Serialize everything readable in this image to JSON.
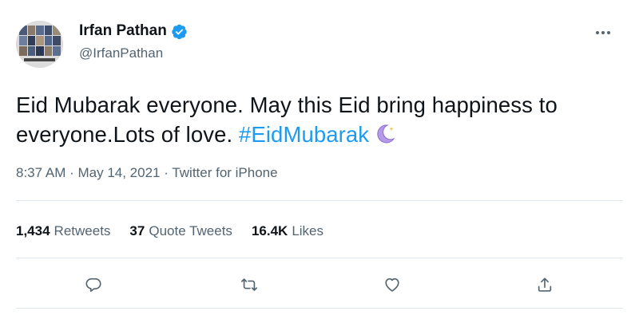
{
  "tweet": {
    "author_name": "Irfan Pathan",
    "handle": "@IrfanPathan",
    "text_main": "Eid Mubarak everyone. May this Eid bring happiness to everyone.Lots of love. ",
    "hashtag": "#EidMubarak",
    "time": "8:37 AM",
    "date": "May 14, 2021",
    "source": "Twitter for iPhone",
    "separator": " · "
  },
  "stats": {
    "retweets_count": "1,434",
    "retweets_label": "Retweets",
    "quotes_count": "37",
    "quotes_label": "Quote Tweets",
    "likes_count": "16.4K",
    "likes_label": "Likes"
  },
  "icons": {
    "verified": "verified-badge-icon",
    "more": "more-options-icon",
    "reply": "reply-icon",
    "retweet": "retweet-icon",
    "like": "like-icon",
    "share": "share-icon",
    "moon": "crescent-moon-emoji"
  },
  "colors": {
    "accent": "#1d9bf0",
    "text": "#0f1419",
    "secondary": "#536471",
    "moon": "#9b7ad8"
  }
}
